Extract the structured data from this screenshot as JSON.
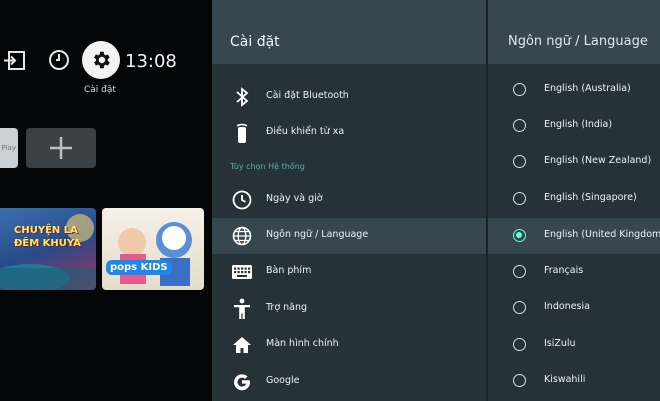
{
  "home": {
    "clock": "13:08",
    "settings_label": "Cài đặt",
    "apps": {
      "partial_label": "Play"
    },
    "thumbnails": [
      {
        "title": "CHUYỆN LA ĐÊM KHUYA"
      },
      {
        "brand": "pops KIDS"
      }
    ]
  },
  "settings": {
    "title": "Cài đặt",
    "items": [
      {
        "label": "Cài đặt Bluetooth",
        "icon": "bluetooth-icon"
      },
      {
        "label": "Điều khiển từ xa",
        "icon": "remote-icon"
      }
    ],
    "section_header": "Tùy chọn Hệ thống",
    "system_items": [
      {
        "label": "Ngày và giờ",
        "icon": "clock-icon"
      },
      {
        "label": "Ngôn ngữ / Language",
        "icon": "globe-icon",
        "selected": true
      },
      {
        "label": "Bàn phím",
        "icon": "keyboard-icon"
      },
      {
        "label": "Trợ năng",
        "icon": "accessibility-icon"
      },
      {
        "label": "Màn hình chính",
        "icon": "home-icon"
      },
      {
        "label": "Google",
        "icon": "google-icon"
      }
    ]
  },
  "language": {
    "title": "Ngôn ngữ / Language",
    "options": [
      {
        "label": "English (Australia)",
        "selected": false
      },
      {
        "label": "English (India)",
        "selected": false
      },
      {
        "label": "English (New Zealand)",
        "selected": false
      },
      {
        "label": "English (Singapore)",
        "selected": false
      },
      {
        "label": "English (United Kingdom)",
        "selected": true
      },
      {
        "label": "Français",
        "selected": false
      },
      {
        "label": "Indonesia",
        "selected": false
      },
      {
        "label": "IsiZulu",
        "selected": false
      },
      {
        "label": "Kiswahili",
        "selected": false
      }
    ]
  },
  "colors": {
    "panel_bg": "#263238",
    "header_bg": "#37474f",
    "accent": "#64ffda",
    "section_header": "#4db6ac"
  }
}
